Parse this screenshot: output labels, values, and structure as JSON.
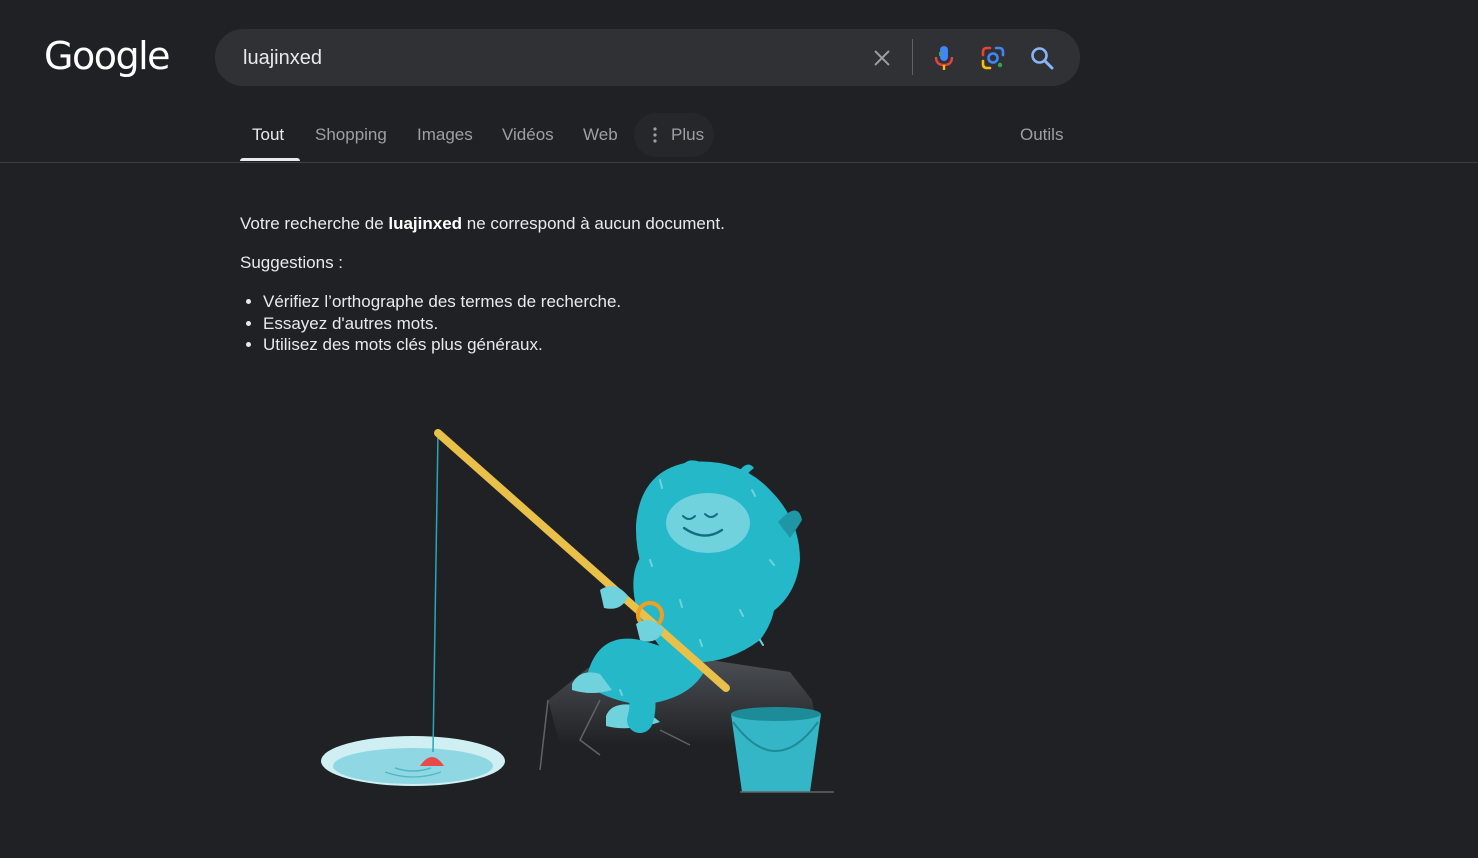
{
  "logo": {
    "text": "Google"
  },
  "search": {
    "query": "luajinxed",
    "icons": [
      "close-icon",
      "microphone-icon",
      "google-lens-icon",
      "search-icon"
    ]
  },
  "tabs": [
    {
      "label": "Tout",
      "active": true
    },
    {
      "label": "Shopping"
    },
    {
      "label": "Images"
    },
    {
      "label": "Vidéos"
    },
    {
      "label": "Web"
    },
    {
      "label": "Plus"
    }
  ],
  "tools": {
    "label": "Outils"
  },
  "result": {
    "prefix": "Votre recherche de ",
    "query": "luajinxed",
    "suffix": " ne correspond à aucun document."
  },
  "suggestions": {
    "title": "Suggestions :",
    "items": [
      "Vérifiez l’orthographe des termes de recherche.",
      "Essayez d'autres mots.",
      "Utilisez des mots clés plus généraux."
    ]
  },
  "illustration": {
    "name": "ice-fishing-monster-illustration"
  },
  "colors": {
    "background": "#202124",
    "searchbox": "#303134",
    "text": "#e8eaed",
    "muted": "#9aa0a6",
    "monster": "#24b8c9",
    "rod": "#e8c04a"
  }
}
